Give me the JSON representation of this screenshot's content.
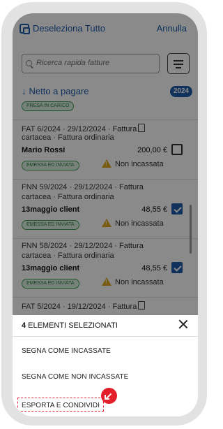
{
  "header": {
    "deselect_label": "Deseleziona Tutto",
    "cancel_label": "Annulla"
  },
  "search": {
    "placeholder": "Ricerca rapida fatture"
  },
  "net": {
    "label": "Netto a pagare",
    "year": "2024"
  },
  "items": [
    {
      "line1": "",
      "line2": "",
      "client": "",
      "amount": "",
      "badge": "PRESA IN CARICO",
      "status": "",
      "checked": true
    },
    {
      "line1": "FAT 6/2024 · 29/12/2024 · Fattura",
      "line2": "cartacea · Fattura ordinaria",
      "client": "Mario Rossi",
      "amount": "200,00 €",
      "badge": "EMESSA ED INVIATA",
      "status": "Non incassata",
      "checked": false
    },
    {
      "line1": "FNN 59/2024 · 29/12/2024 · Fattura",
      "line2": "cartacea · Fattura ordinaria",
      "client": "13maggio client",
      "amount": "48,55 €",
      "badge": "EMESSA ED INVIATA",
      "status": "Non incassata",
      "checked": true
    },
    {
      "line1": "FNN 58/2024 · 29/12/2024 · Fattura",
      "line2": "cartacea · Fattura ordinaria",
      "client": "13maggio client",
      "amount": "48,55 €",
      "badge": "EMESSA ED INVIATA",
      "status": "Non incassata",
      "checked": true
    },
    {
      "line1": "FAT 5/2024 · 19/12/2024 · Fattura",
      "line2": "",
      "client": "",
      "amount": "",
      "badge": "",
      "status": "",
      "checked": true
    }
  ],
  "sheet": {
    "count": "4",
    "title": "ELEMENTI SELEZIONATI",
    "options": [
      "SEGNA COME INCASSATE",
      "SEGNA COME NON INCASSATE",
      "ESPORTA E CONDIVIDI"
    ]
  },
  "colors": {
    "accent": "#1c5ca8",
    "highlight": "#e21f2a",
    "badge_green": "#3c9b51",
    "warning": "#e0a81c"
  }
}
